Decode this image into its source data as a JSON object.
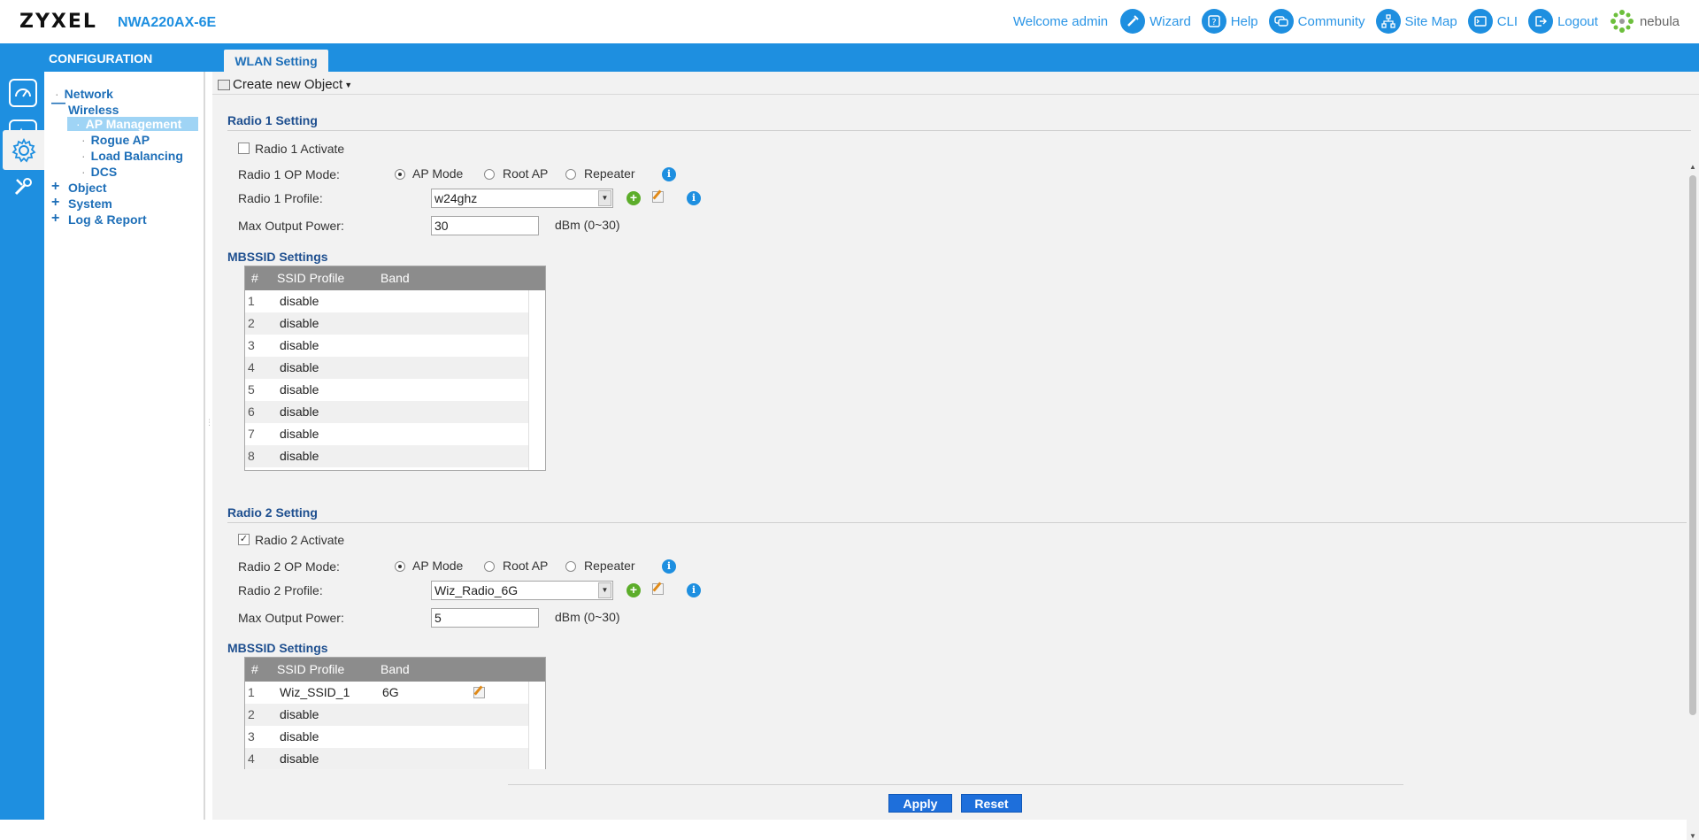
{
  "header": {
    "brand": "ZYXEL",
    "model": "NWA220AX-6E",
    "welcome": "Welcome admin",
    "links": [
      {
        "name": "wizard",
        "label": "Wizard",
        "icon": "wizard-icon"
      },
      {
        "name": "help",
        "label": "Help",
        "icon": "help-icon"
      },
      {
        "name": "community",
        "label": "Community",
        "icon": "community-icon"
      },
      {
        "name": "site-map",
        "label": "Site Map",
        "icon": "sitemap-icon"
      },
      {
        "name": "cli",
        "label": "CLI",
        "icon": "cli-icon"
      },
      {
        "name": "logout",
        "label": "Logout",
        "icon": "logout-icon"
      }
    ],
    "nebula": "nebula"
  },
  "bluebar": {
    "section": "CONFIGURATION",
    "tab": "WLAN Setting"
  },
  "tree": {
    "network": "Network",
    "wireless": "Wireless",
    "ap_management": "AP Management",
    "rogue_ap": "Rogue AP",
    "load_balancing": "Load Balancing",
    "dcs": "DCS",
    "object": "Object",
    "system": "System",
    "log_report": "Log & Report"
  },
  "toolbar": {
    "create_label": "Create new Object"
  },
  "radio1": {
    "title": "Radio 1 Setting",
    "activate_label": "Radio 1 Activate",
    "activate_checked": false,
    "op_mode_label": "Radio 1 OP Mode:",
    "modes": [
      "AP Mode",
      "Root AP",
      "Repeater"
    ],
    "selected_mode": "AP Mode",
    "profile_label": "Radio 1 Profile:",
    "profile_value": "w24ghz",
    "power_label": "Max Output Power:",
    "power_value": "30",
    "power_unit": "dBm (0~30)",
    "mbssid_title": "MBSSID Settings",
    "table": {
      "headers": [
        "#",
        "SSID Profile",
        "Band"
      ],
      "rows": [
        {
          "num": "1",
          "ssid": "disable",
          "band": ""
        },
        {
          "num": "2",
          "ssid": "disable",
          "band": ""
        },
        {
          "num": "3",
          "ssid": "disable",
          "band": ""
        },
        {
          "num": "4",
          "ssid": "disable",
          "band": ""
        },
        {
          "num": "5",
          "ssid": "disable",
          "band": ""
        },
        {
          "num": "6",
          "ssid": "disable",
          "band": ""
        },
        {
          "num": "7",
          "ssid": "disable",
          "band": ""
        },
        {
          "num": "8",
          "ssid": "disable",
          "band": ""
        }
      ]
    }
  },
  "radio2": {
    "title": "Radio 2 Setting",
    "activate_label": "Radio 2 Activate",
    "activate_checked": true,
    "op_mode_label": "Radio 2 OP Mode:",
    "modes": [
      "AP Mode",
      "Root AP",
      "Repeater"
    ],
    "selected_mode": "AP Mode",
    "profile_label": "Radio 2 Profile:",
    "profile_value": "Wiz_Radio_6G",
    "power_label": "Max Output Power:",
    "power_value": "5",
    "power_unit": "dBm (0~30)",
    "mbssid_title": "MBSSID Settings",
    "table": {
      "headers": [
        "#",
        "SSID Profile",
        "Band"
      ],
      "rows": [
        {
          "num": "1",
          "ssid": "Wiz_SSID_1",
          "band": "6G"
        },
        {
          "num": "2",
          "ssid": "disable",
          "band": ""
        },
        {
          "num": "3",
          "ssid": "disable",
          "band": ""
        },
        {
          "num": "4",
          "ssid": "disable",
          "band": ""
        }
      ]
    }
  },
  "buttons": {
    "apply": "Apply",
    "reset": "Reset"
  },
  "colors": {
    "accent": "#1e8fe0",
    "apply_button": "#1e6fdb",
    "tree_link": "#1e6fb8"
  }
}
